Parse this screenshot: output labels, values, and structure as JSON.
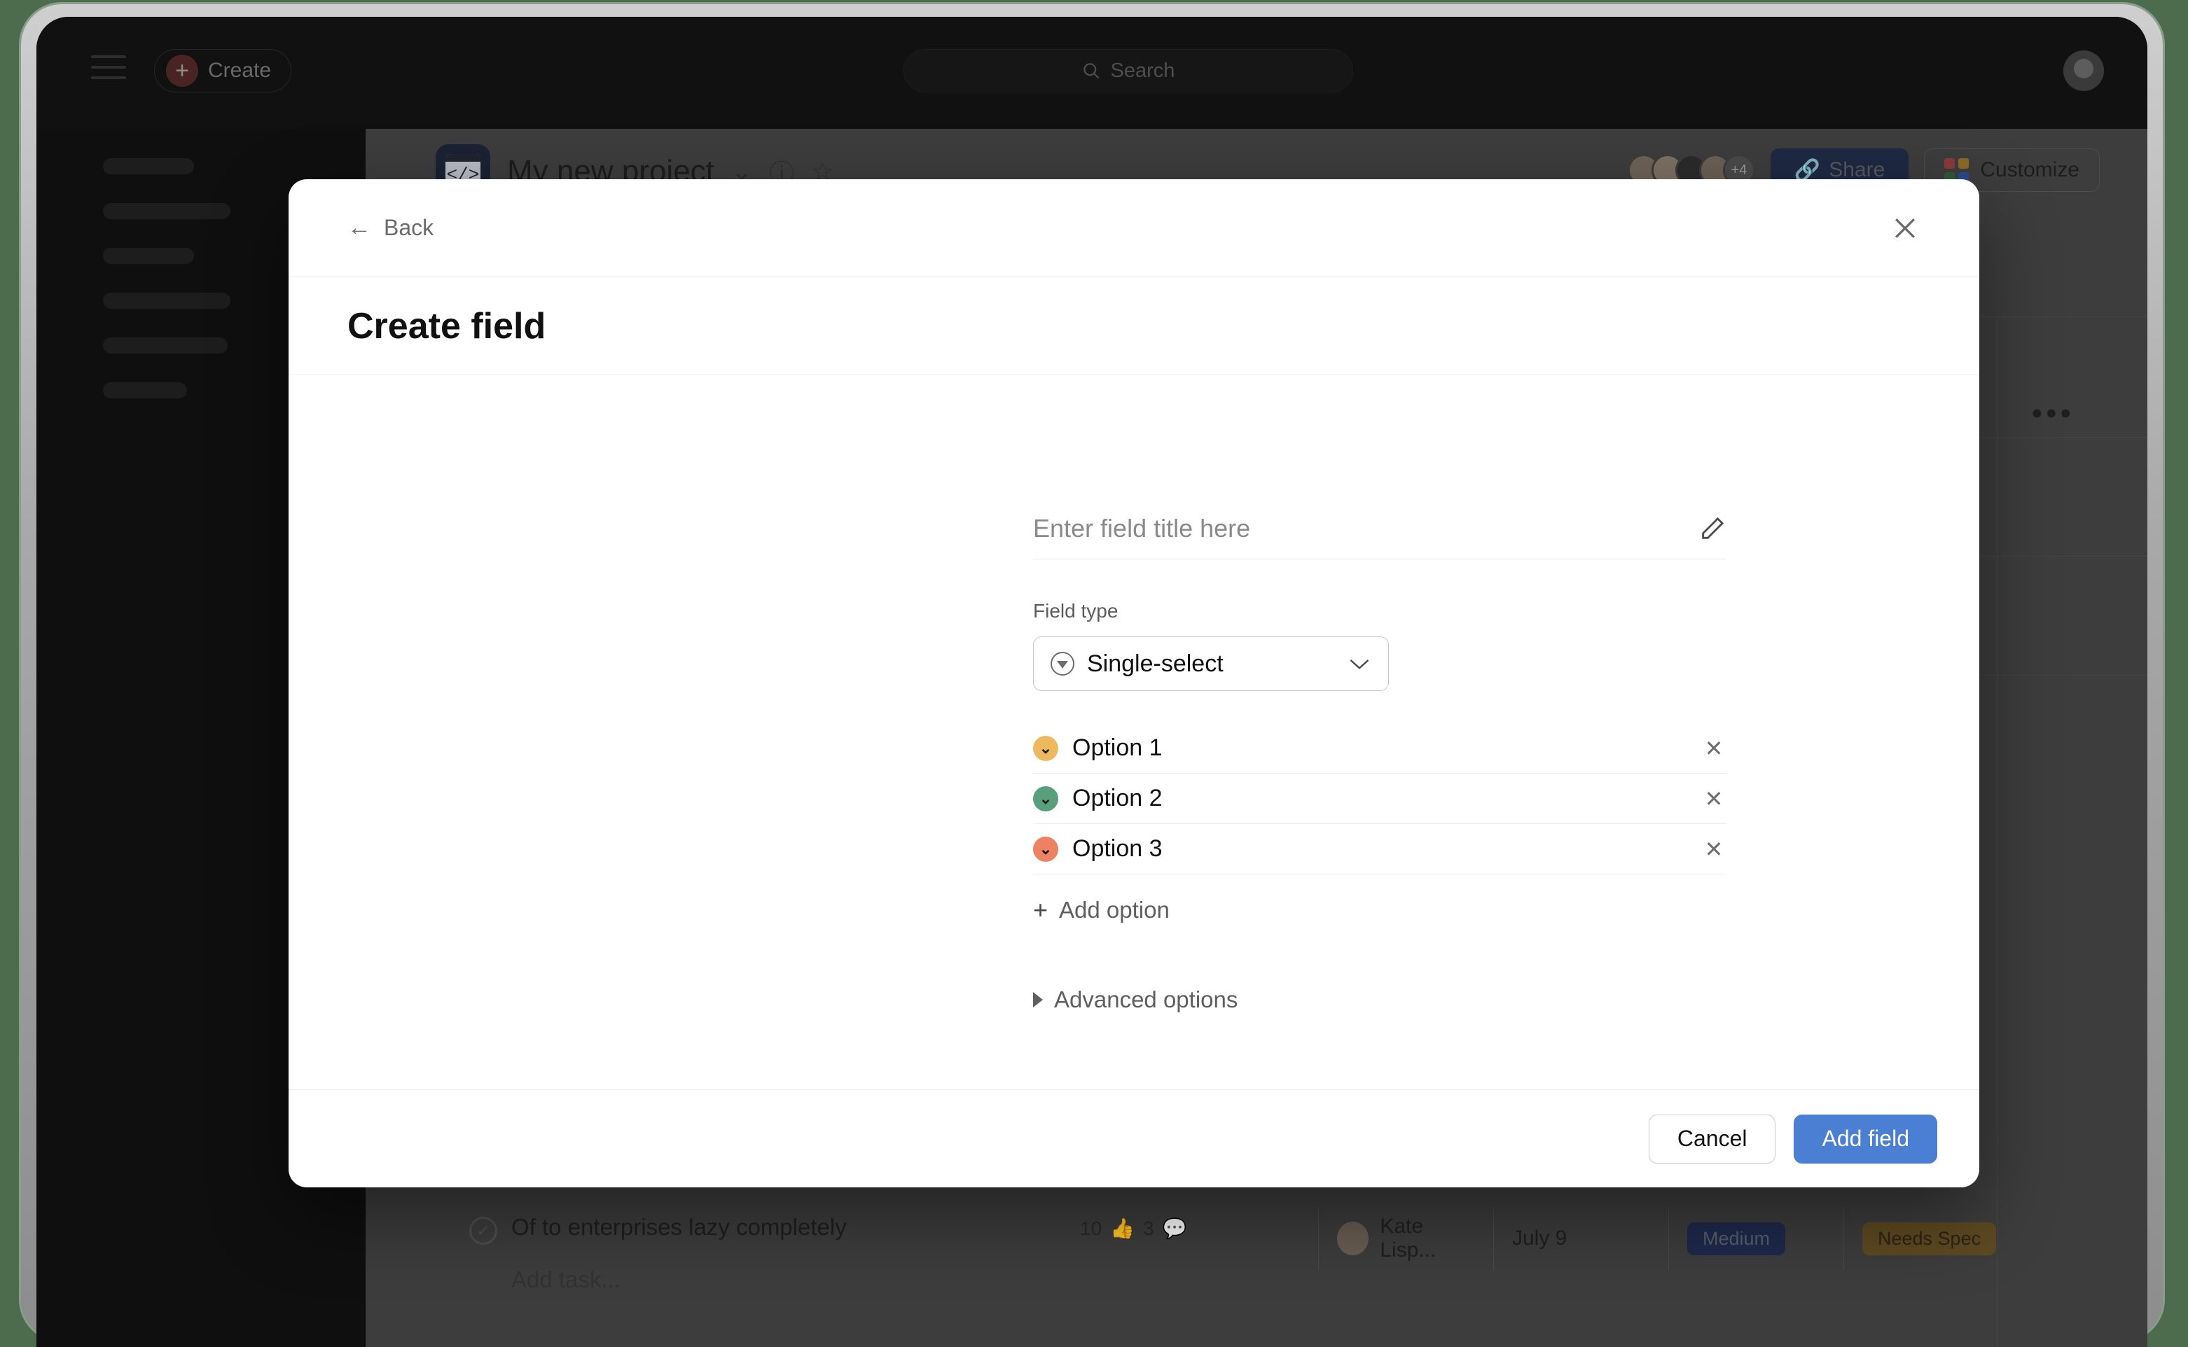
{
  "app": {
    "topbar": {
      "menu_icon": "hamburger-icon",
      "create_label": "Create",
      "create_icon": "plus-icon",
      "search_placeholder": "Search",
      "search_icon": "search-icon",
      "account_icon": "user-avatar"
    },
    "project_header": {
      "icon": "code-window-icon",
      "title": "My new project",
      "chevron": "⌄",
      "info_icon": "ⓘ",
      "star_icon": "☆",
      "avatar_more": "+4",
      "share_label": "Share",
      "share_icon": "share-icon",
      "customize_label": "Customize",
      "customize_icon": "color-grid-icon",
      "customize_colors": [
        "#8a3a3a",
        "#8a6a2a",
        "#2d5a3a",
        "#2a4a8a"
      ],
      "more_menu": "•••",
      "add_column_icon": "+"
    },
    "task_row": {
      "check_icon": "✓",
      "title": "Of to enterprises lazy completely",
      "likes": "10",
      "like_icon": "thumbs-up-icon",
      "comments": "3",
      "comment_icon": "comment-icon",
      "assignee": "Kate Lisp...",
      "date": "July 9",
      "priority": "Medium",
      "priority_color": "#1e2a4d",
      "status": "Needs Spec",
      "status_color": "#5e4a22"
    },
    "add_task_label": "Add task..."
  },
  "modal": {
    "back_label": "Back",
    "back_icon": "arrow-left-icon",
    "close_icon": "close-icon",
    "title": "Create field",
    "field_title": {
      "placeholder": "Enter field title here",
      "edit_icon": "pencil-icon"
    },
    "field_type": {
      "label": "Field type",
      "value": "Single-select",
      "value_icon": "single-select-icon",
      "chevron_icon": "chevron-down-icon"
    },
    "options": [
      {
        "label": "Option 1",
        "color": "#eeb95e",
        "swatch_icon": "chevron-down-icon",
        "remove_icon": "✕"
      },
      {
        "label": "Option 2",
        "color": "#5a9f7c",
        "swatch_icon": "chevron-down-icon",
        "remove_icon": "✕"
      },
      {
        "label": "Option 3",
        "color": "#ec8163",
        "swatch_icon": "chevron-down-icon",
        "remove_icon": "✕"
      }
    ],
    "add_option_label": "Add option",
    "add_option_icon": "plus-icon",
    "advanced_options_label": "Advanced options",
    "advanced_options_icon": "triangle-right-icon",
    "footer": {
      "cancel_label": "Cancel",
      "add_label": "Add field",
      "add_color": "#4a7fd4"
    }
  }
}
